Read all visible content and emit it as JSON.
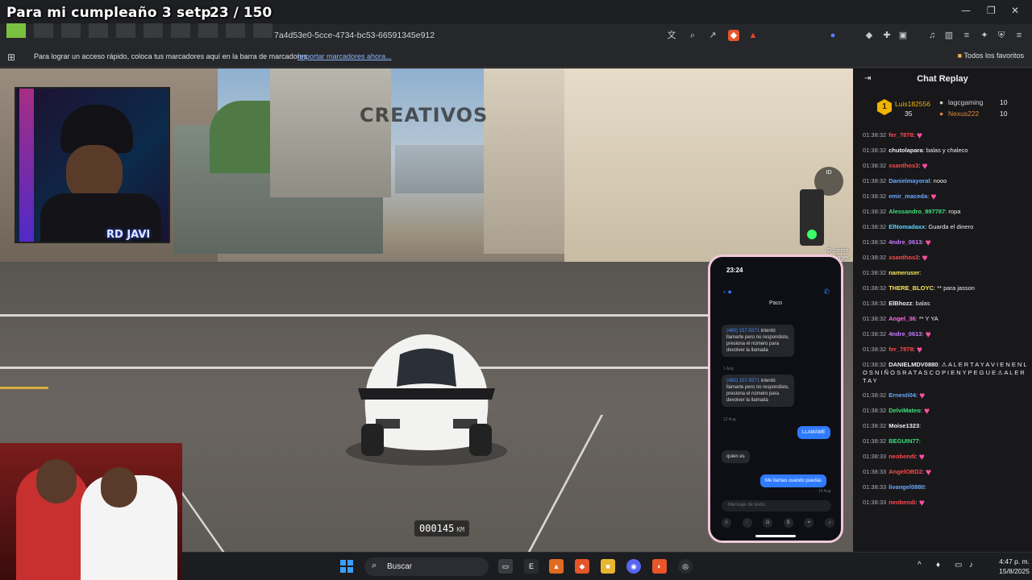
{
  "overlay": {
    "title": "Para mi cumpleaño 3 setp",
    "counter": "23 / 150"
  },
  "browser": {
    "url": "7a4d53e0-5cce-4734-bc53-66591345e912",
    "bookmarks_text": "Para lograr un acceso rápido, coloca tus marcadores aquí en la barra de marcadores.",
    "bookmarks_link": "Importar marcadores ahora...",
    "all_favorites": "Todos los favoritos",
    "window_controls": [
      "—",
      "❐",
      "✕"
    ]
  },
  "game": {
    "logo": "CREATIVOS",
    "odometer": "000145",
    "odometer_unit": "KM",
    "streamer_name": "RD JAVI",
    "hud_lines": [
      "D. perez",
      "vanger"
    ]
  },
  "phone": {
    "time": "23:24",
    "contact": "Paco",
    "messages": [
      {
        "dir": "in",
        "number": "(480) 157-5571",
        "text": "intentó llamarte pero no respondiste, presiona el número para devolver la llamada"
      },
      {
        "dir": "in",
        "number": "(480) 157-5571",
        "text": "intentó llamarte pero no respondiste, presiona el número para devolver la llamada"
      },
      {
        "dir": "out",
        "text": "LLAMAME"
      },
      {
        "dir": "in",
        "text": "quien es"
      },
      {
        "dir": "out",
        "text": "Me llamas cuando puedas"
      }
    ],
    "date_labels": [
      "1 Aug",
      "12 Aug",
      "14 Aug"
    ],
    "input_placeholder": "Mensaje de texto"
  },
  "chat": {
    "title": "Chat Replay",
    "leaderboard": [
      {
        "rank": "1",
        "name": "Luis182556",
        "score": "35",
        "color": "#f0b400"
      },
      {
        "rank": "2",
        "name": "lagcgaming",
        "score": "10",
        "color": "#d0d0d0"
      },
      {
        "rank": "3",
        "name": "Nexus222",
        "score": "10",
        "color": "#e08a3c"
      }
    ],
    "messages": [
      {
        "time": "01:38:32",
        "user": "fer_7878",
        "color": "#ff4a4a",
        "text": "",
        "heart": true
      },
      {
        "time": "01:38:32",
        "user": "chutolapara",
        "color": "#efeff1",
        "text": "balas y chaleco",
        "heart": false
      },
      {
        "time": "01:38:32",
        "user": "xsanthos3",
        "color": "#ff4a4a",
        "text": "",
        "heart": true
      },
      {
        "time": "01:38:32",
        "user": "Danielmayoral",
        "color": "#6aa8ff",
        "text": "nooo",
        "heart": false
      },
      {
        "time": "01:38:32",
        "user": "emir_maceda",
        "color": "#6aa8ff",
        "text": "",
        "heart": true
      },
      {
        "time": "01:38:32",
        "user": "Alessandro_897787",
        "color": "#3ee07a",
        "text": "ropa",
        "heart": false
      },
      {
        "time": "01:38:32",
        "user": "ElNomadaxx",
        "color": "#5cd5ff",
        "text": "Guarda el dinero",
        "heart": false
      },
      {
        "time": "01:38:32",
        "user": "4ndre_0613",
        "color": "#c77dff",
        "text": "",
        "heart": true
      },
      {
        "time": "01:38:32",
        "user": "xsanthos3",
        "color": "#ff4a4a",
        "text": "",
        "heart": true
      },
      {
        "time": "01:38:32",
        "user": "nameruser",
        "color": "#f5e35a",
        "text": "",
        "heart": false
      },
      {
        "time": "01:38:32",
        "user": "THERE_BLOYC",
        "color": "#f5e35a",
        "text": "** para jasson",
        "heart": false
      },
      {
        "time": "01:38:32",
        "user": "ElBhozz",
        "color": "#efeff1",
        "text": "balas",
        "heart": false
      },
      {
        "time": "01:38:32",
        "user": "Angel_36",
        "color": "#ff6adf",
        "text": "** Y YA",
        "heart": false
      },
      {
        "time": "01:38:32",
        "user": "4ndre_0613",
        "color": "#c77dff",
        "text": "",
        "heart": true
      },
      {
        "time": "01:38:32",
        "user": "fer_7878",
        "color": "#ff4a4a",
        "text": "",
        "heart": true
      },
      {
        "time": "01:38:32",
        "user": "DANIELMDV0880",
        "color": "#efeff1",
        "text": "⚠ A L E R T A Y A V I E N E N L O S N I Ñ O S R A T A S C O P I E N Y P E G U E ⚠ A L E R T A Y",
        "heart": false
      },
      {
        "time": "01:38:32",
        "user": "Ernesti04",
        "color": "#6aa8ff",
        "text": "",
        "heart": true
      },
      {
        "time": "01:38:32",
        "user": "DelviMateo",
        "color": "#3ee07a",
        "text": "",
        "heart": true
      },
      {
        "time": "01:38:32",
        "user": "Moise1323",
        "color": "#efeff1",
        "text": "",
        "heart": false
      },
      {
        "time": "01:38:32",
        "user": "BEGUIN77",
        "color": "#3ee07a",
        "text": "",
        "heart": false
      },
      {
        "time": "01:38:33",
        "user": "neobendi",
        "color": "#ff4a4a",
        "text": "",
        "heart": true
      },
      {
        "time": "01:38:33",
        "user": "AngelOBD2",
        "color": "#ff4a4a",
        "text": "",
        "heart": true
      },
      {
        "time": "01:38:33",
        "user": "livangel0880",
        "color": "#6aa8ff",
        "text": "",
        "heart": false
      },
      {
        "time": "01:38:33",
        "user": "neobendi",
        "color": "#ff4a4a",
        "text": "",
        "heart": true
      }
    ]
  },
  "taskbar": {
    "search_label": "Buscar",
    "time": "4:47 p. m.",
    "date": "15/8/2025"
  }
}
